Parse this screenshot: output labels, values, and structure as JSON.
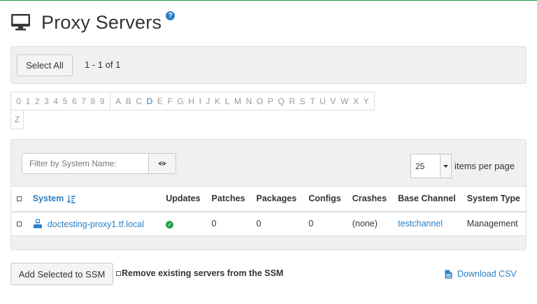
{
  "page": {
    "title": "Proxy Servers",
    "help_glyph": "?"
  },
  "toolbar": {
    "select_all_label": "Select All",
    "range_text": "1 - 1 of 1"
  },
  "alphabet": {
    "digits": [
      "0",
      "1",
      "2",
      "3",
      "4",
      "5",
      "6",
      "7",
      "8",
      "9"
    ],
    "letters": [
      "A",
      "B",
      "C",
      "D",
      "E",
      "F",
      "G",
      "H",
      "I",
      "J",
      "K",
      "L",
      "M",
      "N",
      "O",
      "P",
      "Q",
      "R",
      "S",
      "T",
      "U",
      "V",
      "W",
      "X",
      "Y"
    ],
    "overflow_letter": "Z",
    "active_letter": "D"
  },
  "filter": {
    "placeholder": "Filter by System Name:"
  },
  "pagination": {
    "items_per_page_value": "25",
    "items_per_page_label": "items per page"
  },
  "table": {
    "columns": [
      "System",
      "Updates",
      "Patches",
      "Packages",
      "Configs",
      "Crashes",
      "Base Channel",
      "System Type"
    ],
    "rows": [
      {
        "system": "doctesting-proxy1.tf.local",
        "updates_status": "ok",
        "patches": "0",
        "packages": "0",
        "configs": "0",
        "crashes": "(none)",
        "base_channel": "testchannel",
        "system_type": "Management"
      }
    ]
  },
  "footer": {
    "add_ssm_label": "Add Selected to SSM",
    "remove_label": "Remove existing servers from the SSM",
    "download_label": "Download CSV"
  },
  "colors": {
    "accent": "#2a7fc6",
    "success": "#1fa44f",
    "top_line": "#1f9e4b"
  }
}
